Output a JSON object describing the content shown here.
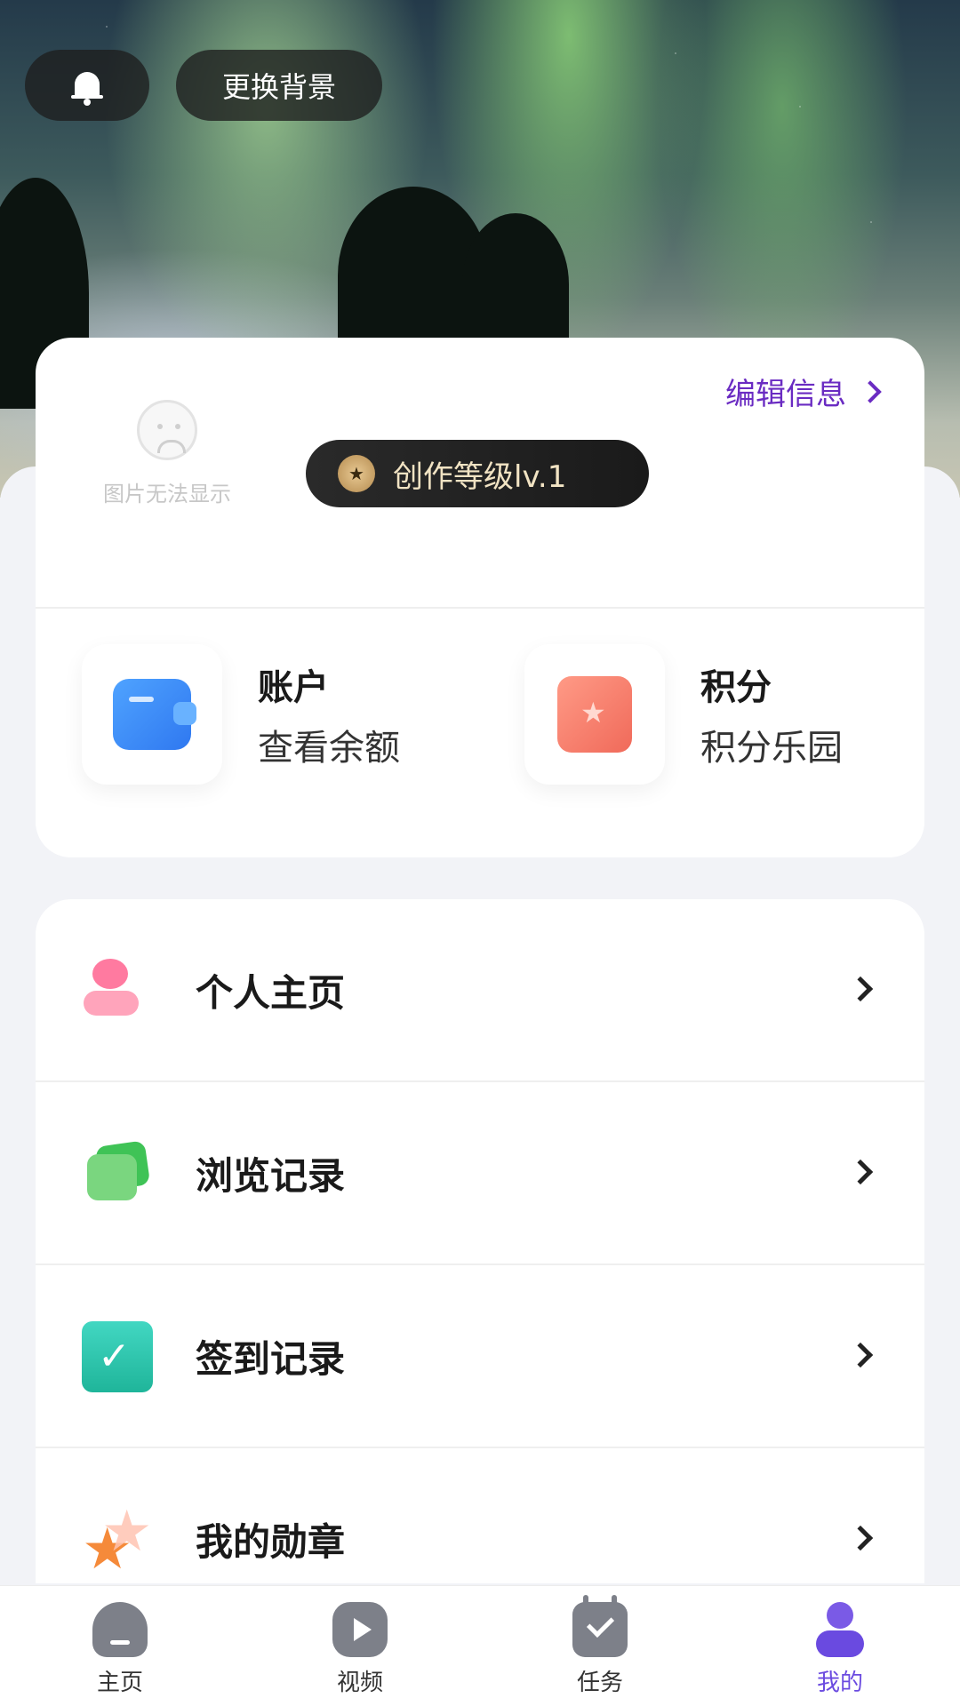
{
  "header": {
    "change_bg_label": "更换背景"
  },
  "profile": {
    "edit_label": "编辑信息",
    "avatar_fallback_text": "图片无法显示",
    "level_label": "创作等级lv.1"
  },
  "quick_actions": [
    {
      "title": "账户",
      "subtitle": "查看余额",
      "icon": "wallet-icon"
    },
    {
      "title": "积分",
      "subtitle": "积分乐园",
      "icon": "points-icon"
    }
  ],
  "menu": [
    {
      "label": "个人主页",
      "icon": "person-icon"
    },
    {
      "label": "浏览记录",
      "icon": "browse-history-icon"
    },
    {
      "label": "签到记录",
      "icon": "checkin-calendar-icon"
    },
    {
      "label": "我的勋章",
      "icon": "medal-stars-icon"
    }
  ],
  "tabbar": {
    "items": [
      {
        "label": "主页",
        "icon": "home-icon"
      },
      {
        "label": "视频",
        "icon": "video-play-icon"
      },
      {
        "label": "任务",
        "icon": "task-calendar-icon"
      },
      {
        "label": "我的",
        "icon": "profile-icon",
        "active": true
      }
    ],
    "active_color": "#6b4be0"
  },
  "colors": {
    "accent_purple": "#6a2bc2",
    "level_pill_bg": "#1e1e1e",
    "page_bg": "#f2f3f7"
  }
}
